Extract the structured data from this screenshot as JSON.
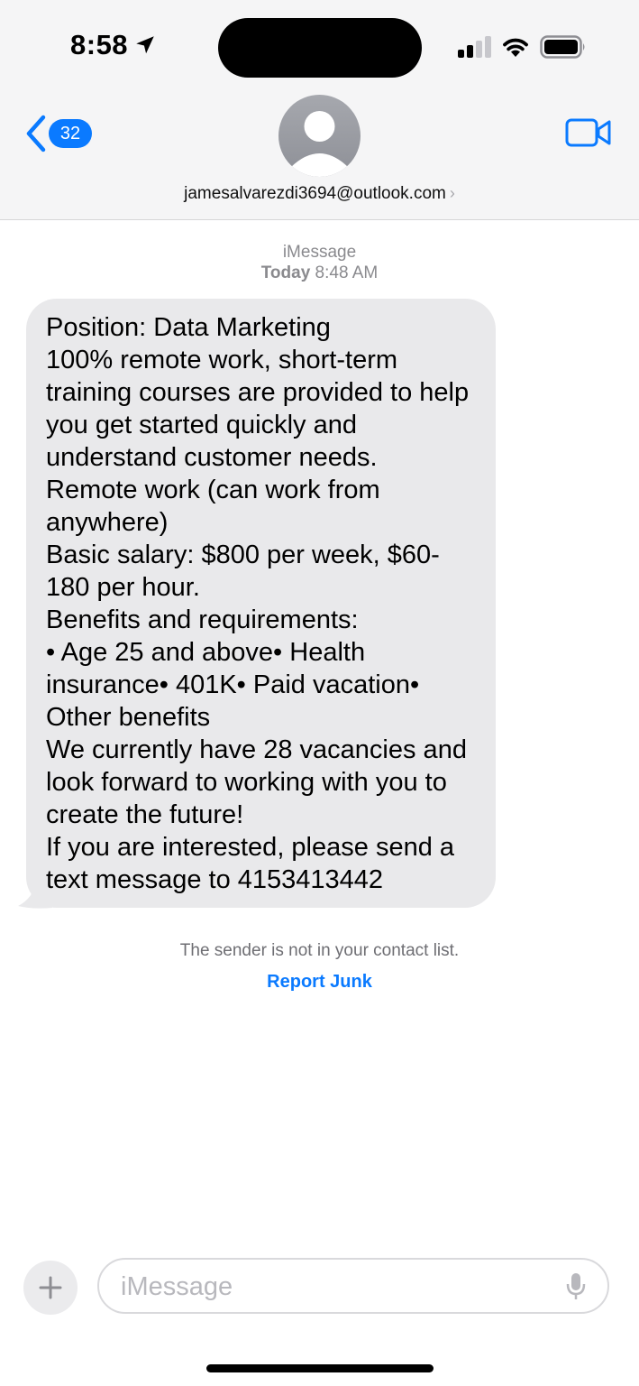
{
  "status_bar": {
    "time": "8:58",
    "icons": [
      "location-arrow-icon",
      "cellular-signal-icon",
      "wifi-icon",
      "battery-icon"
    ]
  },
  "header": {
    "back_badge_count": "32",
    "contact_address": "jamesalvarezdi3694@outlook.com",
    "contact_chevron": "›",
    "icons": [
      "back-chevron-icon",
      "person-avatar-icon",
      "video-camera-icon"
    ]
  },
  "conversation": {
    "service_label": "iMessage",
    "day_label": "Today",
    "time_label": "8:48 AM",
    "message_text": "Position: Data Marketing\n100% remote work, short-term training courses are provided to help you get started quickly and understand customer needs.\nRemote work (can work from anywhere)\nBasic salary: $800 per week, $60-180 per hour.\nBenefits and requirements:\n• Age 25 and above• Health insurance• 401K• Paid vacation• Other benefits\nWe currently have 28 vacancies and look forward to working with you to create the future!\nIf you are interested, please send a text message to 4153413442",
    "sender_note": "The sender is not in your contact list.",
    "report_junk_label": "Report Junk"
  },
  "compose": {
    "placeholder": "iMessage",
    "value": "",
    "icons": [
      "plus-icon",
      "microphone-icon"
    ]
  },
  "colors": {
    "accent": "#0a7aff",
    "bubble_gray": "#e9e9eb",
    "header_bg": "#f5f5f6"
  }
}
